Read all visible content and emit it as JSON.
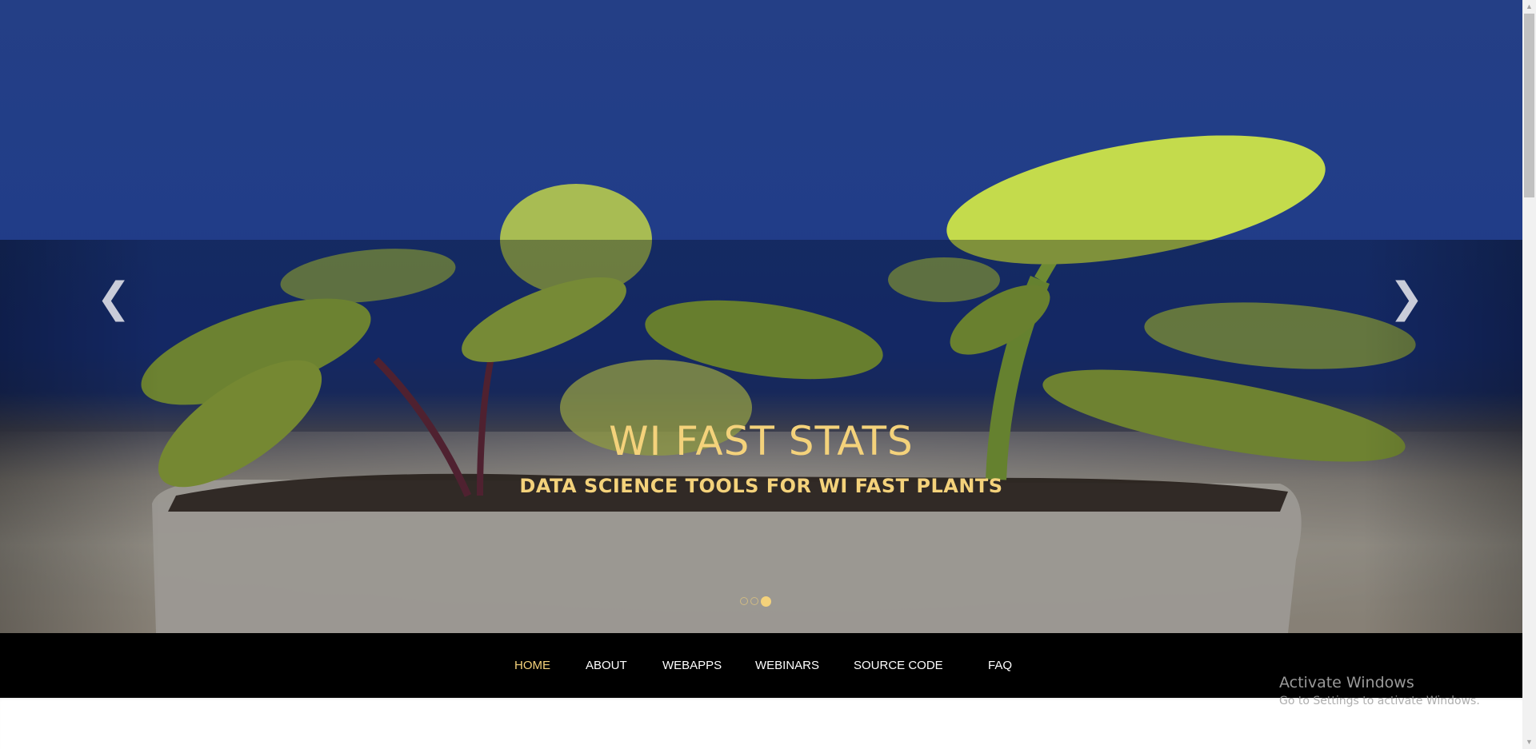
{
  "carousel": {
    "prev_icon": "❮",
    "next_icon": "❯",
    "title": "WI FAST STATS",
    "subtitle": "DATA SCIENCE TOOLS FOR WI FAST PLANTS",
    "slide_count": 3,
    "active_slide": 3,
    "accent_color": "#f4d27b"
  },
  "nav": {
    "items": [
      {
        "label": "HOME",
        "active": true
      },
      {
        "label": "ABOUT",
        "active": false
      },
      {
        "label": "WEBAPPS",
        "active": false
      },
      {
        "label": "WEBINARS",
        "active": false
      },
      {
        "label": "SOURCE CODE",
        "active": false
      },
      {
        "label": "FAQ",
        "active": false
      }
    ]
  },
  "watermark": {
    "title": "Activate Windows",
    "subtitle": "Go to Settings to activate Windows."
  },
  "scrollbar": {
    "up_icon": "▲",
    "down_icon": "▼"
  }
}
